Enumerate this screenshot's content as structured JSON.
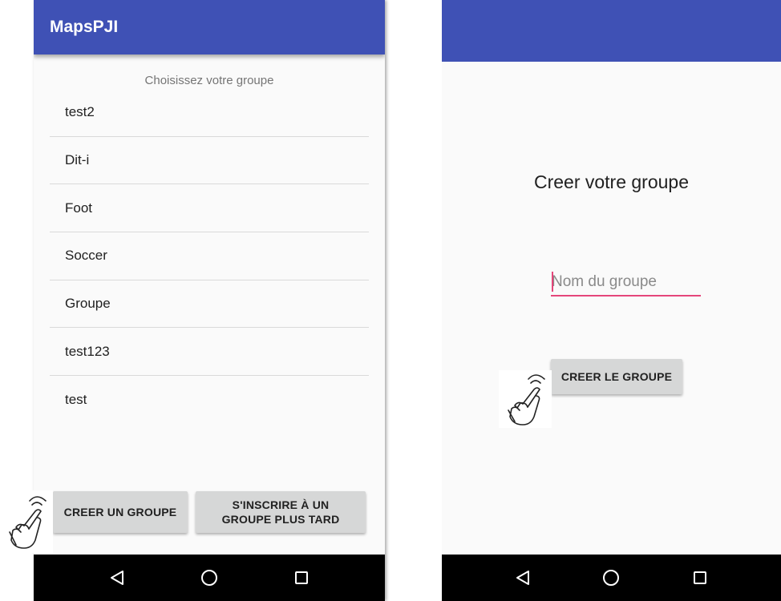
{
  "left_screen": {
    "app_title": "MapsPJI",
    "list_header": "Choisissez votre groupe",
    "groups": [
      {
        "name": "test2"
      },
      {
        "name": "Dit-i"
      },
      {
        "name": "Foot"
      },
      {
        "name": "Soccer"
      },
      {
        "name": "Groupe"
      },
      {
        "name": "test123"
      },
      {
        "name": "test"
      }
    ],
    "create_button_label": "CREER UN GROUPE",
    "register_later_line1": "S'INSCRIRE À UN",
    "register_later_line2": "GROUPE PLUS TARD"
  },
  "right_screen": {
    "app_title": "",
    "heading": "Creer votre groupe",
    "name_input": {
      "value": "",
      "placeholder": "Nom du groupe"
    },
    "create_button_label": "CREER LE GROUPE"
  },
  "navigation": {
    "icons": [
      "back-icon",
      "home-icon",
      "recents-icon"
    ]
  },
  "colors": {
    "app_bar": "#3f51b5",
    "input_accent": "#e5467a",
    "button_bg": "#d6d7d7",
    "nav_bar": "#000000"
  },
  "annotations": {
    "icon": "tap-hand-icon"
  }
}
